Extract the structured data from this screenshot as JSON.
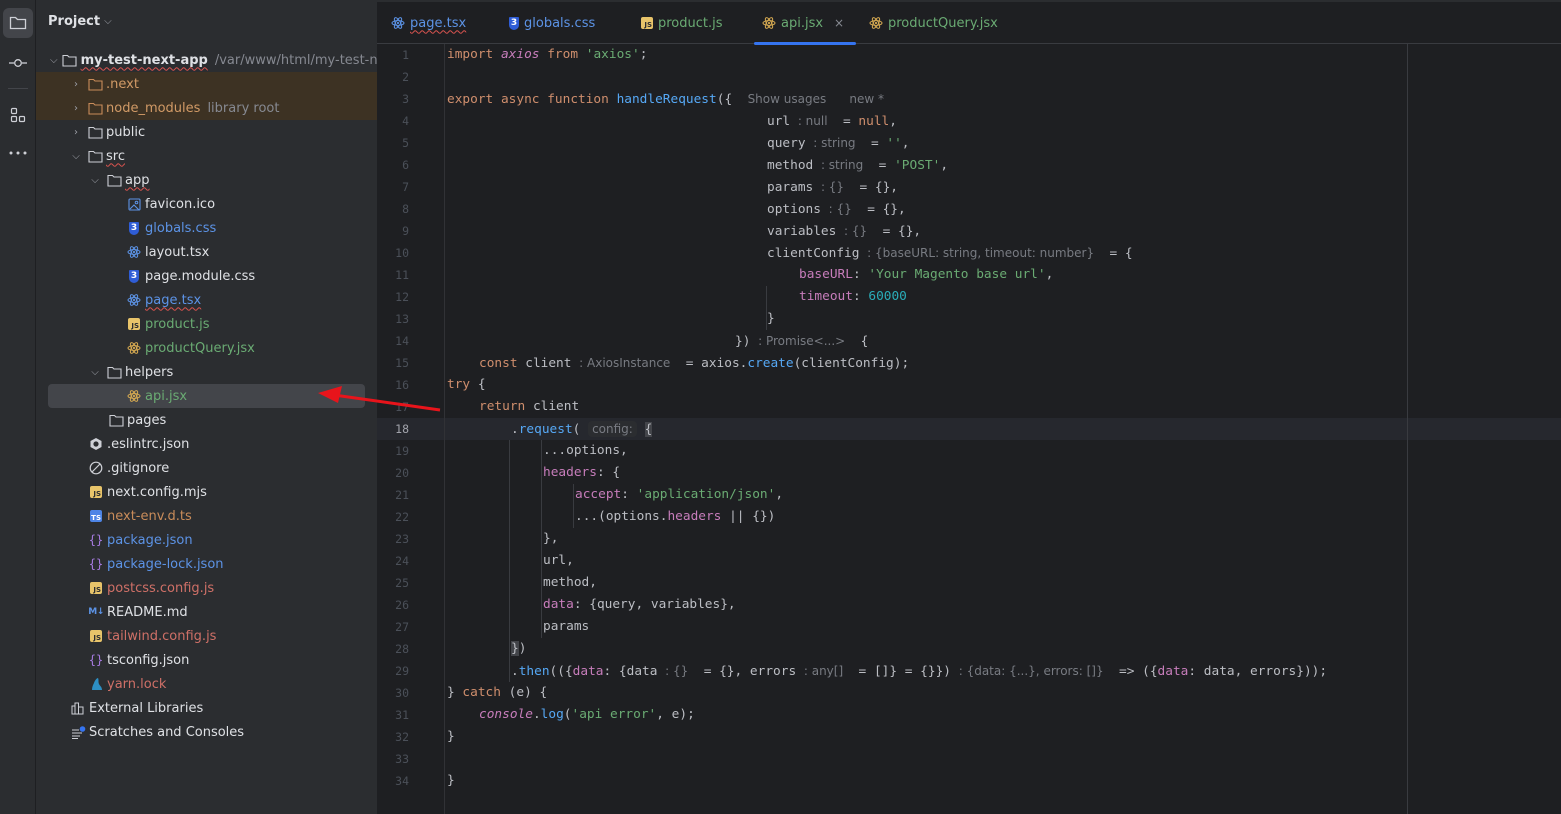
{
  "activity_bar": {
    "items": [
      {
        "name": "project",
        "icon": "folder-icon",
        "active": true
      },
      {
        "name": "commit",
        "icon": "commit-icon",
        "active": false
      },
      {
        "name": "structure",
        "icon": "structure-icon",
        "active": false
      },
      {
        "name": "more",
        "icon": "more-icon",
        "active": false
      }
    ]
  },
  "project_panel": {
    "title": "Project",
    "root": {
      "label": "my-test-next-app",
      "path": "/var/www/html/my-test-ne"
    },
    "items": [
      {
        "label": ".next",
        "type": "folder",
        "level": 1,
        "collapsed": true,
        "excluded": true
      },
      {
        "label": "node_modules",
        "hint": "library root",
        "type": "folder",
        "level": 1,
        "collapsed": true,
        "excluded": true
      },
      {
        "label": "public",
        "type": "folder",
        "level": 1,
        "collapsed": true
      },
      {
        "label": "src",
        "type": "folder",
        "level": 1,
        "expanded": true
      },
      {
        "label": "app",
        "type": "folder",
        "level": 2,
        "expanded": true
      },
      {
        "label": "favicon.ico",
        "type": "image",
        "level": 3
      },
      {
        "label": "globals.css",
        "type": "css",
        "level": 3
      },
      {
        "label": "layout.tsx",
        "type": "react",
        "level": 3
      },
      {
        "label": "page.module.css",
        "type": "css",
        "level": 3
      },
      {
        "label": "page.tsx",
        "type": "react",
        "level": 3
      },
      {
        "label": "product.js",
        "type": "js",
        "level": 3
      },
      {
        "label": "productQuery.jsx",
        "type": "react-jsx",
        "level": 3
      },
      {
        "label": "helpers",
        "type": "folder",
        "level": 2,
        "expanded": true
      },
      {
        "label": "api.jsx",
        "type": "react-jsx",
        "level": 3,
        "selected": true
      },
      {
        "label": "pages",
        "type": "folder",
        "level": 2
      },
      {
        "label": ".eslintrc.json",
        "type": "eslint",
        "level": 1
      },
      {
        "label": ".gitignore",
        "type": "ignore",
        "level": 1
      },
      {
        "label": "next.config.mjs",
        "type": "js",
        "level": 1
      },
      {
        "label": "next-env.d.ts",
        "type": "ts",
        "level": 1
      },
      {
        "label": "package.json",
        "type": "json",
        "level": 1
      },
      {
        "label": "package-lock.json",
        "type": "json",
        "level": 1
      },
      {
        "label": "postcss.config.js",
        "type": "js",
        "level": 1
      },
      {
        "label": "README.md",
        "type": "md",
        "level": 1
      },
      {
        "label": "tailwind.config.js",
        "type": "js",
        "level": 1
      },
      {
        "label": "tsconfig.json",
        "type": "json",
        "level": 1
      },
      {
        "label": "yarn.lock",
        "type": "yarn",
        "level": 1
      }
    ],
    "bottom": [
      {
        "label": "External Libraries",
        "icon": "library-icon"
      },
      {
        "label": "Scratches and Consoles",
        "icon": "scratches-icon"
      }
    ]
  },
  "tabs": [
    {
      "label": "page.tsx",
      "icon": "react-icon"
    },
    {
      "label": "globals.css",
      "icon": "css-icon"
    },
    {
      "label": "product.js",
      "icon": "js-icon"
    },
    {
      "label": "api.jsx",
      "icon": "react-icon",
      "active": true,
      "close": "×"
    },
    {
      "label": "productQuery.jsx",
      "icon": "react-icon"
    }
  ],
  "editor": {
    "current_line": 18,
    "line_numbers": [
      "1",
      "2",
      "3",
      "4",
      "5",
      "6",
      "7",
      "8",
      "9",
      "10",
      "11",
      "12",
      "13",
      "14",
      "15",
      "16",
      "17",
      "18",
      "19",
      "20",
      "21",
      "22",
      "23",
      "24",
      "25",
      "26",
      "27",
      "28",
      "29",
      "30",
      "31",
      "32",
      "33",
      "34"
    ],
    "inlay": {
      "show_usages": "Show usages",
      "new_marker": "new *",
      "url_type": ": null",
      "query_type": ": string",
      "method_type": ": string",
      "params_type": ": {}",
      "options_type": ": {}",
      "variables_type": ": {}",
      "clientConfig_type": ": {baseURL: string, timeout: number}",
      "return_type": ": Promise<...>",
      "client_type": ": AxiosInstance",
      "config_param": "config:",
      "data_type": ": {}",
      "errors_type": ": any[]",
      "then_type": ": {data: {...}, errors: []}"
    },
    "tokens": {
      "import": "import",
      "axios": "axios",
      "from": "from",
      "axios_str": "'axios'",
      "export": "export",
      "async": "async",
      "function": "function",
      "handleRequest": "handleRequest",
      "null": "null",
      "empty_str": "''",
      "post_str": "'POST'",
      "baseURL": "baseURL",
      "base_url_str": "'Your Magento base url'",
      "timeout": "timeout",
      "timeout_val": "60000",
      "const": "const",
      "create": "create",
      "try": "try",
      "return": "return",
      "request": "request",
      "headers": "headers",
      "accept": "accept",
      "json_str": "'application/json'",
      "data": "data",
      "then": "then",
      "catch": "catch",
      "console": "console",
      "log": "log",
      "api_error_str": "'api error'"
    }
  },
  "annotation": {
    "arrow_color": "#e8141b"
  }
}
